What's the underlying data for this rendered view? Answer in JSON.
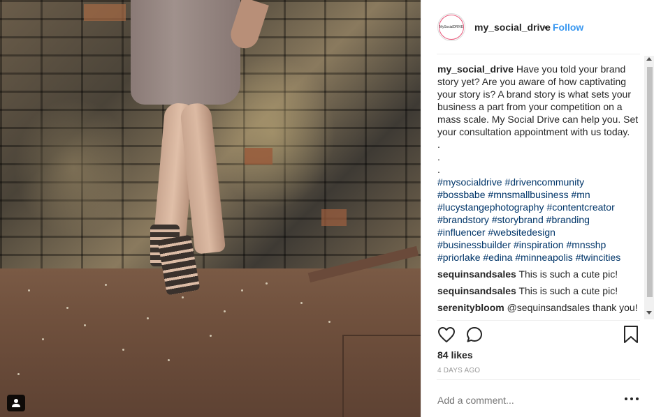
{
  "post": {
    "username": "my_social_drive",
    "separator": "•",
    "follow_label": "Follow",
    "avatar_text": "MySocialDRIVE"
  },
  "caption": {
    "author": "my_social_drive",
    "text": "Have you told your brand story yet? Are you aware of how captivating your story is? A brand story is what sets your business a part from your competition on a mass scale. My Social Drive can help you. Set your consultation appointment with us today.",
    "dots": [
      ".",
      ".",
      "."
    ],
    "hashtags": [
      "#mysocialdrive",
      "#drivencommunity",
      "#bossbabe",
      "#mnsmallbusiness",
      "#mn",
      "#lucystangephotography",
      "#contentcreator",
      "#brandstory",
      "#storybrand",
      "#branding",
      "#influencer",
      "#websitedesign",
      "#businessbuilder",
      "#inspiration",
      "#mnsshp",
      "#priorlake",
      "#edina",
      "#minneapolis",
      "#twincities"
    ]
  },
  "comments": [
    {
      "author": "sequinsandsales",
      "text": "This is such a cute pic!"
    },
    {
      "author": "sequinsandsales",
      "text": "This is such a cute pic!"
    },
    {
      "author": "serenitybloom",
      "text": "@sequinsandsales thank you!"
    }
  ],
  "likes_label": "84 likes",
  "date_label": "4 DAYS AGO",
  "add_comment_placeholder": "Add a comment...",
  "icons": {
    "like": "heart-icon",
    "comment": "speech-bubble-icon",
    "save": "bookmark-icon",
    "more": "more-horizontal-icon",
    "tag": "user-tag-icon"
  },
  "colors": {
    "link_blue": "#3897f0",
    "hashtag": "#003569",
    "text": "#262626",
    "muted": "#999999"
  }
}
